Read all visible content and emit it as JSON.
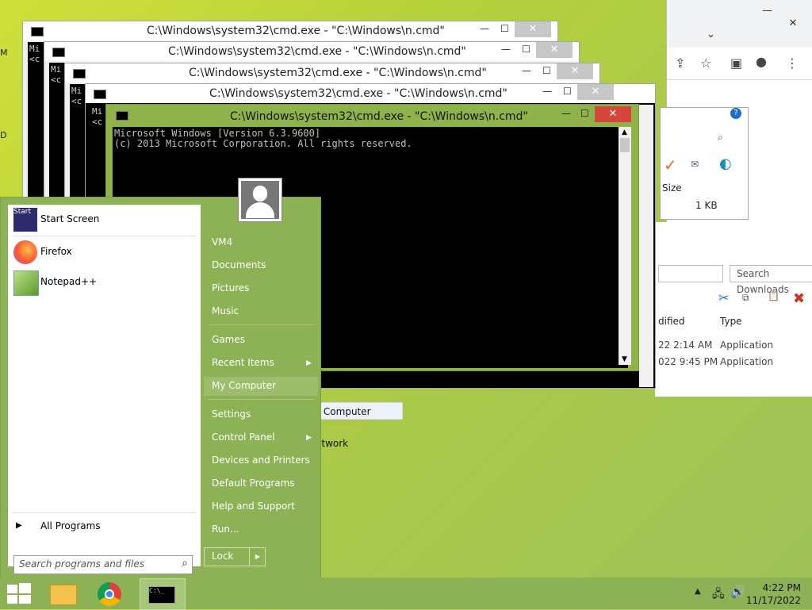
{
  "desktop": {
    "left_fragments": [
      "M",
      "D"
    ]
  },
  "cmd_windows": [
    {
      "title": "C:\\Windows\\system32\\cmd.exe - \"C:\\Windows\\n.cmd\"",
      "body": "Mi\n<c"
    },
    {
      "title": "C:\\Windows\\system32\\cmd.exe - \"C:\\Windows\\n.cmd\"",
      "body": "Mi\n<c"
    },
    {
      "title": "C:\\Windows\\system32\\cmd.exe - \"C:\\Windows\\n.cmd\"",
      "body": "Mi\n<c"
    },
    {
      "title": "C:\\Windows\\system32\\cmd.exe - \"C:\\Windows\\n.cmd\"",
      "body": "Mi\n<c"
    }
  ],
  "front_cmd": {
    "title": "C:\\Windows\\system32\\cmd.exe - \"C:\\Windows\\n.cmd\"",
    "lines": [
      "Microsoft Windows [Version 6.3.9600]",
      "(c) 2013 Microsoft Corporation. All rights reserved."
    ]
  },
  "explorer": {
    "size_header": "Size",
    "size_value": "1 KB",
    "search_placeholder": "Search Downloads",
    "col_modified": "dified",
    "col_type": "Type",
    "rows": [
      {
        "date": "22 2:14 AM",
        "type": "Application"
      },
      {
        "date": "022 9:45 PM",
        "type": "Application"
      }
    ],
    "nav_my_computer": "y Computer",
    "nav_network": "etwork"
  },
  "start_menu": {
    "programs": [
      {
        "label": "Start Screen"
      },
      {
        "label": "Firefox"
      },
      {
        "label": "Notepad++"
      }
    ],
    "all_programs": "All Programs",
    "search_placeholder": "Search programs and files",
    "right": [
      "VM4",
      "Documents",
      "Pictures",
      "Music",
      "Games",
      "Recent Items",
      "My Computer",
      "Settings",
      "Control Panel",
      "Devices and Printers",
      "Default Programs",
      "Help and Support",
      "Run..."
    ],
    "lock": "Lock"
  },
  "taskbar": {
    "time": "4:22 PM",
    "date": "11/17/2022"
  },
  "colors": {
    "accent": "#8db255",
    "close_red": "#d6443a"
  }
}
